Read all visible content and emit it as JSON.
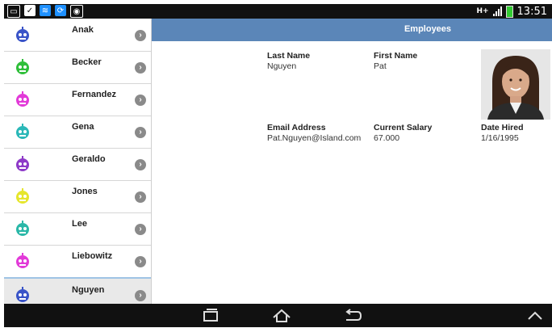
{
  "status_bar": {
    "time": "13:51",
    "network": "H+"
  },
  "header": {
    "title": "Employees"
  },
  "employees": [
    {
      "name": "Anak",
      "color": "#3a54c8"
    },
    {
      "name": "Becker",
      "color": "#2fbf3a"
    },
    {
      "name": "Fernandez",
      "color": "#e23ad8"
    },
    {
      "name": "Gena",
      "color": "#2ab8b8"
    },
    {
      "name": "Geraldo",
      "color": "#8e3ac8"
    },
    {
      "name": "Jones",
      "color": "#e6e62c"
    },
    {
      "name": "Lee",
      "color": "#2ab8a8"
    },
    {
      "name": "Liebowitz",
      "color": "#e23ad8"
    },
    {
      "name": "Nguyen",
      "color": "#3a54c8"
    }
  ],
  "selected_employee": "Nguyen",
  "detail": {
    "last_name_label": "Last Name",
    "last_name": "Nguyen",
    "first_name_label": "First Name",
    "first_name": "Pat",
    "email_label": "Email Address",
    "email": "Pat.Nguyen@Island.com",
    "salary_label": "Current Salary",
    "salary": "67.000",
    "hired_label": "Date Hired",
    "hired": "1/16/1995"
  }
}
